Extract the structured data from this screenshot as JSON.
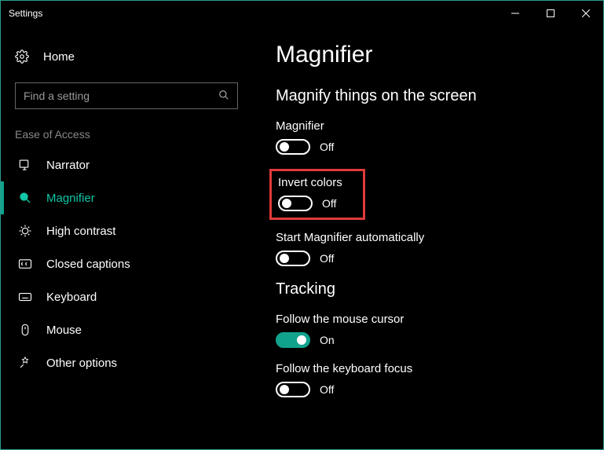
{
  "window": {
    "title": "Settings"
  },
  "sidebar": {
    "home_label": "Home",
    "search_placeholder": "Find a setting",
    "category_label": "Ease of Access",
    "items": [
      {
        "label": "Narrator",
        "active": false
      },
      {
        "label": "Magnifier",
        "active": true
      },
      {
        "label": "High contrast",
        "active": false
      },
      {
        "label": "Closed captions",
        "active": false
      },
      {
        "label": "Keyboard",
        "active": false
      },
      {
        "label": "Mouse",
        "active": false
      },
      {
        "label": "Other options",
        "active": false
      }
    ]
  },
  "main": {
    "page_title": "Magnifier",
    "section1_title": "Magnify things on the screen",
    "settings": {
      "magnifier": {
        "label": "Magnifier",
        "state": "Off",
        "on": false
      },
      "invert_colors": {
        "label": "Invert colors",
        "state": "Off",
        "on": false,
        "highlighted": true
      },
      "auto_start": {
        "label": "Start Magnifier automatically",
        "state": "Off",
        "on": false
      }
    },
    "section2_title": "Tracking",
    "tracking": {
      "mouse": {
        "label": "Follow the mouse cursor",
        "state": "On",
        "on": true
      },
      "keyboard": {
        "label": "Follow the keyboard focus",
        "state": "Off",
        "on": false
      }
    }
  },
  "colors": {
    "accent": "#11a28c",
    "highlight": "#e03b3b"
  }
}
